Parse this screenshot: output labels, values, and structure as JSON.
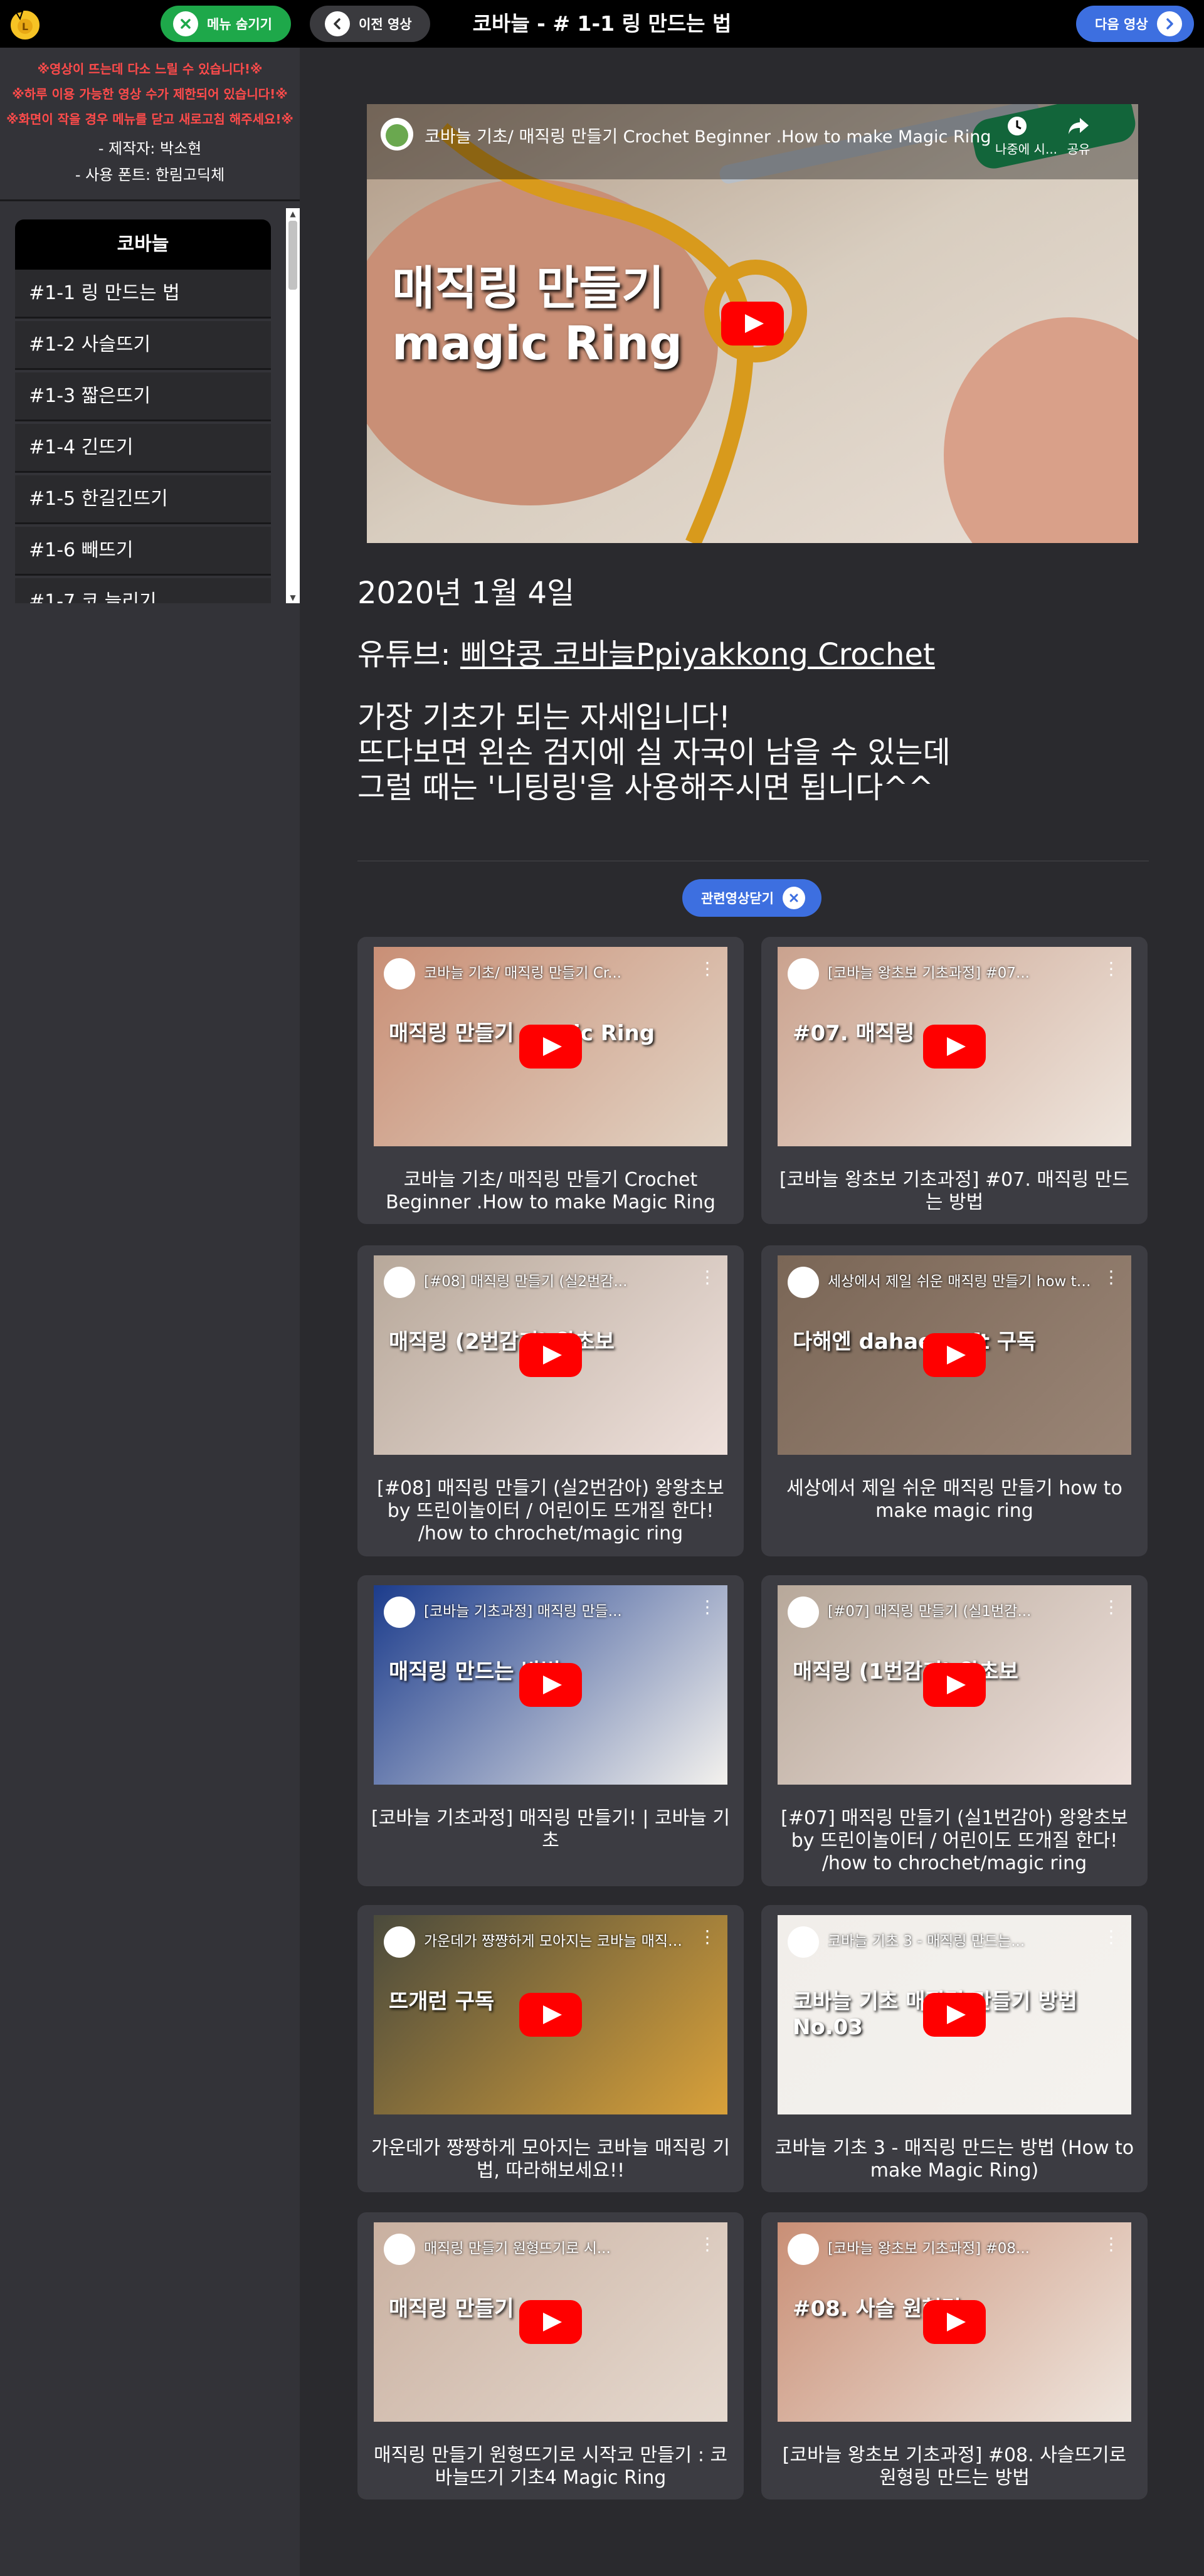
{
  "header": {
    "title": "코바늘 - # 1-1 링 만드는 법",
    "menu_hide_label": "메뉴 숨기기",
    "prev_label": "이전 영상",
    "next_label": "다음 영상"
  },
  "sidebar": {
    "notices": [
      "※영상이 뜨는데 다소 느릴 수 있습니다!※",
      "※하루 이용 가능한 영상 수가 제한되어 있습니다!※",
      "※화면이 작을 경우 메뉴를 닫고 새로고침 해주세요!※"
    ],
    "author": "- 제작자: 박소현",
    "font": "- 사용 폰트: 한림고딕체",
    "category": "코바늘",
    "items": [
      "#1-1 링 만드는 법",
      "#1-2 사슬뜨기",
      "#1-3 짧은뜨기",
      "#1-4 긴뜨기",
      "#1-5 한길긴뜨기",
      "#1-6 빼뜨기",
      "#1-7 코 늘리기"
    ]
  },
  "player": {
    "title": "코바늘 기초/ 매직링 만들기 Crochet Beginner .How to make Magic Ring",
    "watch_later": "나중에 시...",
    "share": "공유",
    "overlay_line1": "매직링 만들기",
    "overlay_line2": "magic Ring"
  },
  "info": {
    "date": "2020년 1월 4일",
    "youtube_prefix": "유튜브: ",
    "youtube_channel": "삐약콩 코바늘Ppiyakkong Crochet",
    "desc1": "가장 기초가 되는 자세입니다!",
    "desc2": "뜨다보면 왼손 검지에 실 자국이 남을 수 있는데",
    "desc3": "그럴 때는 '니팅링'을 사용해주시면 됩니다^^"
  },
  "related": {
    "close_label": "관련영상닫기",
    "cards": [
      {
        "thumb_title": "코바늘 기초/ 매직링 만들기 Cr...",
        "overlay": "매직링 만들기 magic Ring",
        "title": "코바늘 기초/ 매직링 만들기 Crochet Beginner .How to make Magic Ring"
      },
      {
        "thumb_title": "[코바늘 왕초보 기초과정] #07...",
        "overlay": "#07. 매직링",
        "title": "[코바늘 왕초보 기초과정] #07. 매직링 만드는 방법"
      },
      {
        "thumb_title": "[#08] 매직링 만들기 (실2번감...",
        "overlay": "매직링 (2번감기) 왕초보",
        "title": "[#08] 매직링 만들기 (실2번감아) 왕왕초보 by 뜨린이놀이터 / 어린이도 뜨개질 한다! /how to chrochet/magic ring"
      },
      {
        "thumb_title": "세상에서 제일 쉬운 매직링 만들기 how to make magic ring",
        "overlay": "다해엔 dahaecraft 구독",
        "title": "세상에서 제일 쉬운 매직링 만들기 how to make magic ring"
      },
      {
        "thumb_title": "[코바늘 기초과정] 매직링 만들...",
        "overlay": "매직링 만드는 방법",
        "title": "[코바늘 기초과정] 매직링 만들기! | 코바늘 기초"
      },
      {
        "thumb_title": "[#07] 매직링 만들기 (실1번감...",
        "overlay": "매직링 (1번감기) 왕초보",
        "title": "[#07] 매직링 만들기 (실1번감아) 왕왕초보 by 뜨린이놀이터 / 어린이도 뜨개질 한다! /how to chrochet/magic ring"
      },
      {
        "thumb_title": "가운데가 쨩쨩하게 모아지는 코바늘 매직링 기법, 따라해보세요!!",
        "overlay": "뜨개런 구독",
        "title": "가운데가 쨩쨩하게 모아지는 코바늘 매직링 기법, 따라해보세요!!"
      },
      {
        "thumb_title": "코바늘 기초 3 - 매직링 만드는...",
        "overlay": "코바늘 기초 매직링 만들기 방법 No.03",
        "title": "코바늘 기초 3 - 매직링 만드는 방법 (How to make Magic Ring)"
      },
      {
        "thumb_title": "매직링 만들기 원형뜨기로 시...",
        "overlay": "매직링 만들기",
        "title": "매직링 만들기 원형뜨기로 시작코 만들기 : 코바늘뜨기 기초4 Magic Ring"
      },
      {
        "thumb_title": "[코바늘 왕초보 기초과정] #08...",
        "overlay": "#08. 사슬 원형링",
        "title": "[코바늘 왕초보 기초과정] #08. 사슬뜨기로 원형링 만드는 방법"
      }
    ]
  },
  "colors": {
    "menu_hide": "#1ea84a",
    "next": "#3d6fe0",
    "notice": "#ff4b4b",
    "yt_red": "#ff0000"
  }
}
